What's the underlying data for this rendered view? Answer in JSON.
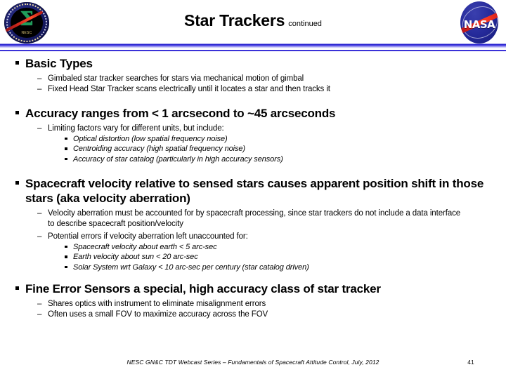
{
  "header": {
    "title": "Star Trackers",
    "title_suffix": "continued",
    "left_logo": {
      "name": "nesc-seal",
      "sigma_glyph": "Σ",
      "ring_caption": "NASA ENGINEERING & SAFETY CENTER",
      "sub_caption": "NESC"
    },
    "right_logo": {
      "name": "nasa-meatball",
      "wordmark": "NASA"
    }
  },
  "body": {
    "sections": [
      {
        "heading": "Basic Types",
        "sub": [
          {
            "dash": "–",
            "text": "Gimbaled star tracker searches for stars via mechanical motion of gimbal",
            "items": []
          },
          {
            "dash": "–",
            "text": "Fixed Head Star Tracker scans electrically until it locates a star and then tracks it",
            "items": []
          }
        ]
      },
      {
        "heading": "Accuracy ranges from < 1 arcsecond to ~45 arcseconds",
        "sub": [
          {
            "dash": "–",
            "text": "Limiting factors vary for different units, but include:",
            "items": [
              "Optical distortion (low spatial frequency noise)",
              "Centroiding accuracy (high spatial frequency noise)",
              "Accuracy of star catalog (particularly in high accuracy sensors)"
            ]
          }
        ]
      },
      {
        "heading": "Spacecraft velocity relative to sensed stars causes apparent position shift in those stars (aka velocity aberration)",
        "sub": [
          {
            "dash": "–",
            "text": "Velocity aberration must be accounted for by spacecraft processing, since star trackers do not include a data interface to describe spacecraft position/velocity",
            "items": []
          },
          {
            "dash": "–",
            "text": "Potential errors if velocity aberration left unaccounted for:",
            "items": [
              "Spacecraft velocity about earth < 5 arc-sec",
              "Earth velocity about sun < 20 arc-sec",
              "Solar System wrt Galaxy < 10 arc-sec per century (star catalog driven)"
            ]
          }
        ]
      },
      {
        "heading": "Fine Error Sensors a special, high accuracy class of star tracker",
        "sub": [
          {
            "dash": "–",
            "text": "Shares optics with instrument to eliminate misalignment errors",
            "items": []
          },
          {
            "dash": "–",
            "text": "Often uses a small FOV to maximize accuracy across the FOV",
            "items": []
          }
        ]
      }
    ]
  },
  "footer": {
    "text": "NESC GN&C TDT Webcast Series – Fundamentals of Spacecraft Attitude Control, July, 2012",
    "page_number": "41"
  },
  "colors": {
    "divider_blue": "#1a14c8",
    "nasa_blue": "#252a9a",
    "nasa_red": "#e2241c",
    "nesc_green": "#1f9e5a",
    "text": "#000000"
  }
}
